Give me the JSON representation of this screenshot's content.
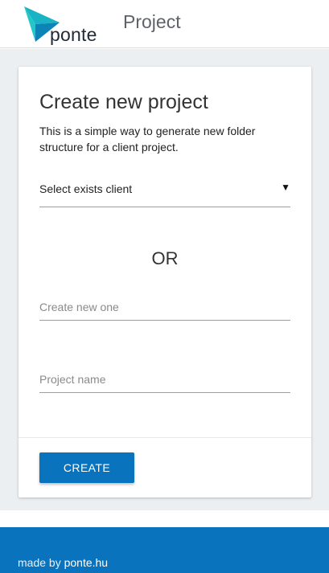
{
  "header": {
    "logo_text": "ponte",
    "title": "Project"
  },
  "card": {
    "title": "Create new project",
    "description": "This is a simple way to generate new folder structure for a client project.",
    "client_select": {
      "label": "Select exists client"
    },
    "or_label": "OR",
    "new_client_field": {
      "placeholder": "Create new one",
      "value": ""
    },
    "project_name_field": {
      "placeholder": "Project name",
      "value": ""
    },
    "create_button": "CREATE"
  },
  "footer": {
    "prefix": "made by ",
    "link": "ponte.hu"
  },
  "colors": {
    "accent": "#0a73bd",
    "logo_teal": "#19b3c4",
    "background": "#eceff1"
  },
  "icons": {
    "logo": "ponte-triangle-logo",
    "dropdown": "caret-down-icon"
  }
}
